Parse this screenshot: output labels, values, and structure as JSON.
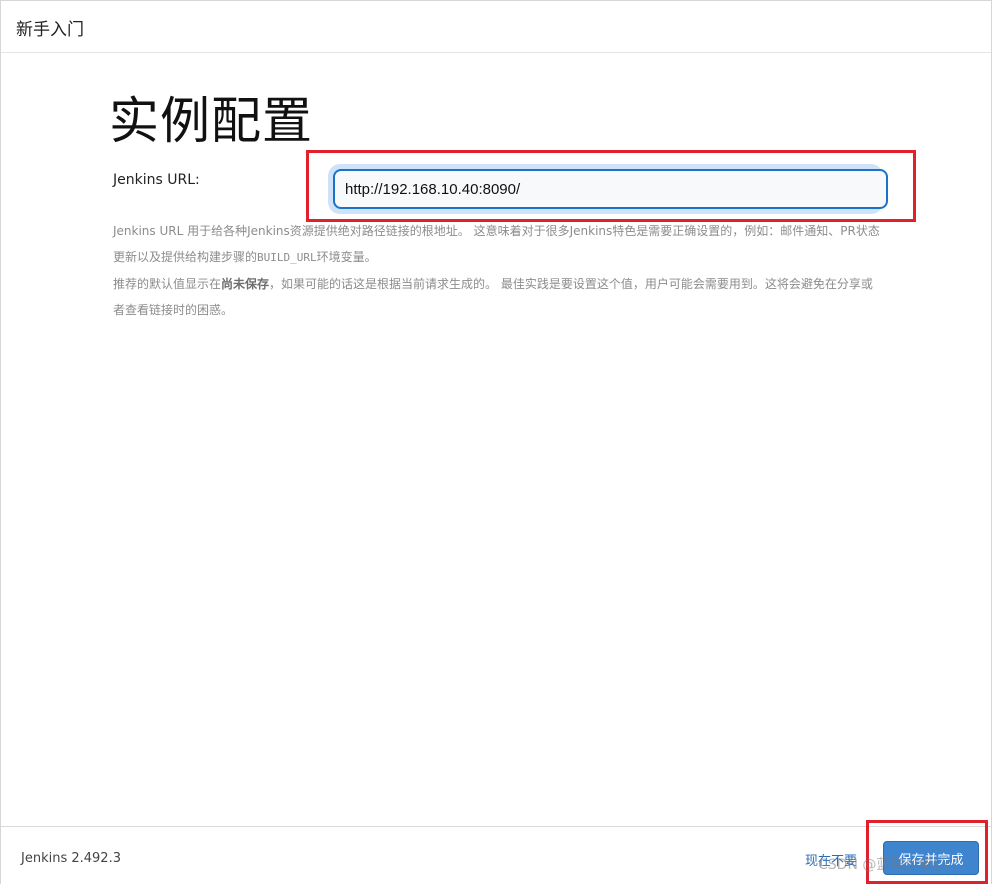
{
  "header": {
    "title": "新手入门"
  },
  "main": {
    "heading": "实例配置",
    "url_label": "Jenkins URL:",
    "url_value": "http://192.168.10.40:8090/",
    "help": {
      "p1_a": "Jenkins URL 用于给各种Jenkins资源提供绝对路径链接的根地址。 这意味着对于很多Jenkins特色是需要正确设置的，例如：邮件通知、PR状态更新以及提供给构建步骤的",
      "p1_code": "BUILD_URL",
      "p1_b": "环境变量。",
      "p2_a": "推荐的默认值显示在",
      "p2_strong": "尚未保存",
      "p2_b": "，如果可能的话这是根据当前请求生成的。 最佳实践是要设置这个值，用户可能会需要用到。这将会避免在分享或者查看链接时的困惑。"
    }
  },
  "footer": {
    "version": "Jenkins 2.492.3",
    "skip_label": "现在不要",
    "save_label": "保存并完成"
  },
  "watermark": "CSDN @蓝眸少年CY",
  "colors": {
    "accent": "#3f84cf",
    "highlight": "#e0202a",
    "input_border": "#1a73c9"
  }
}
